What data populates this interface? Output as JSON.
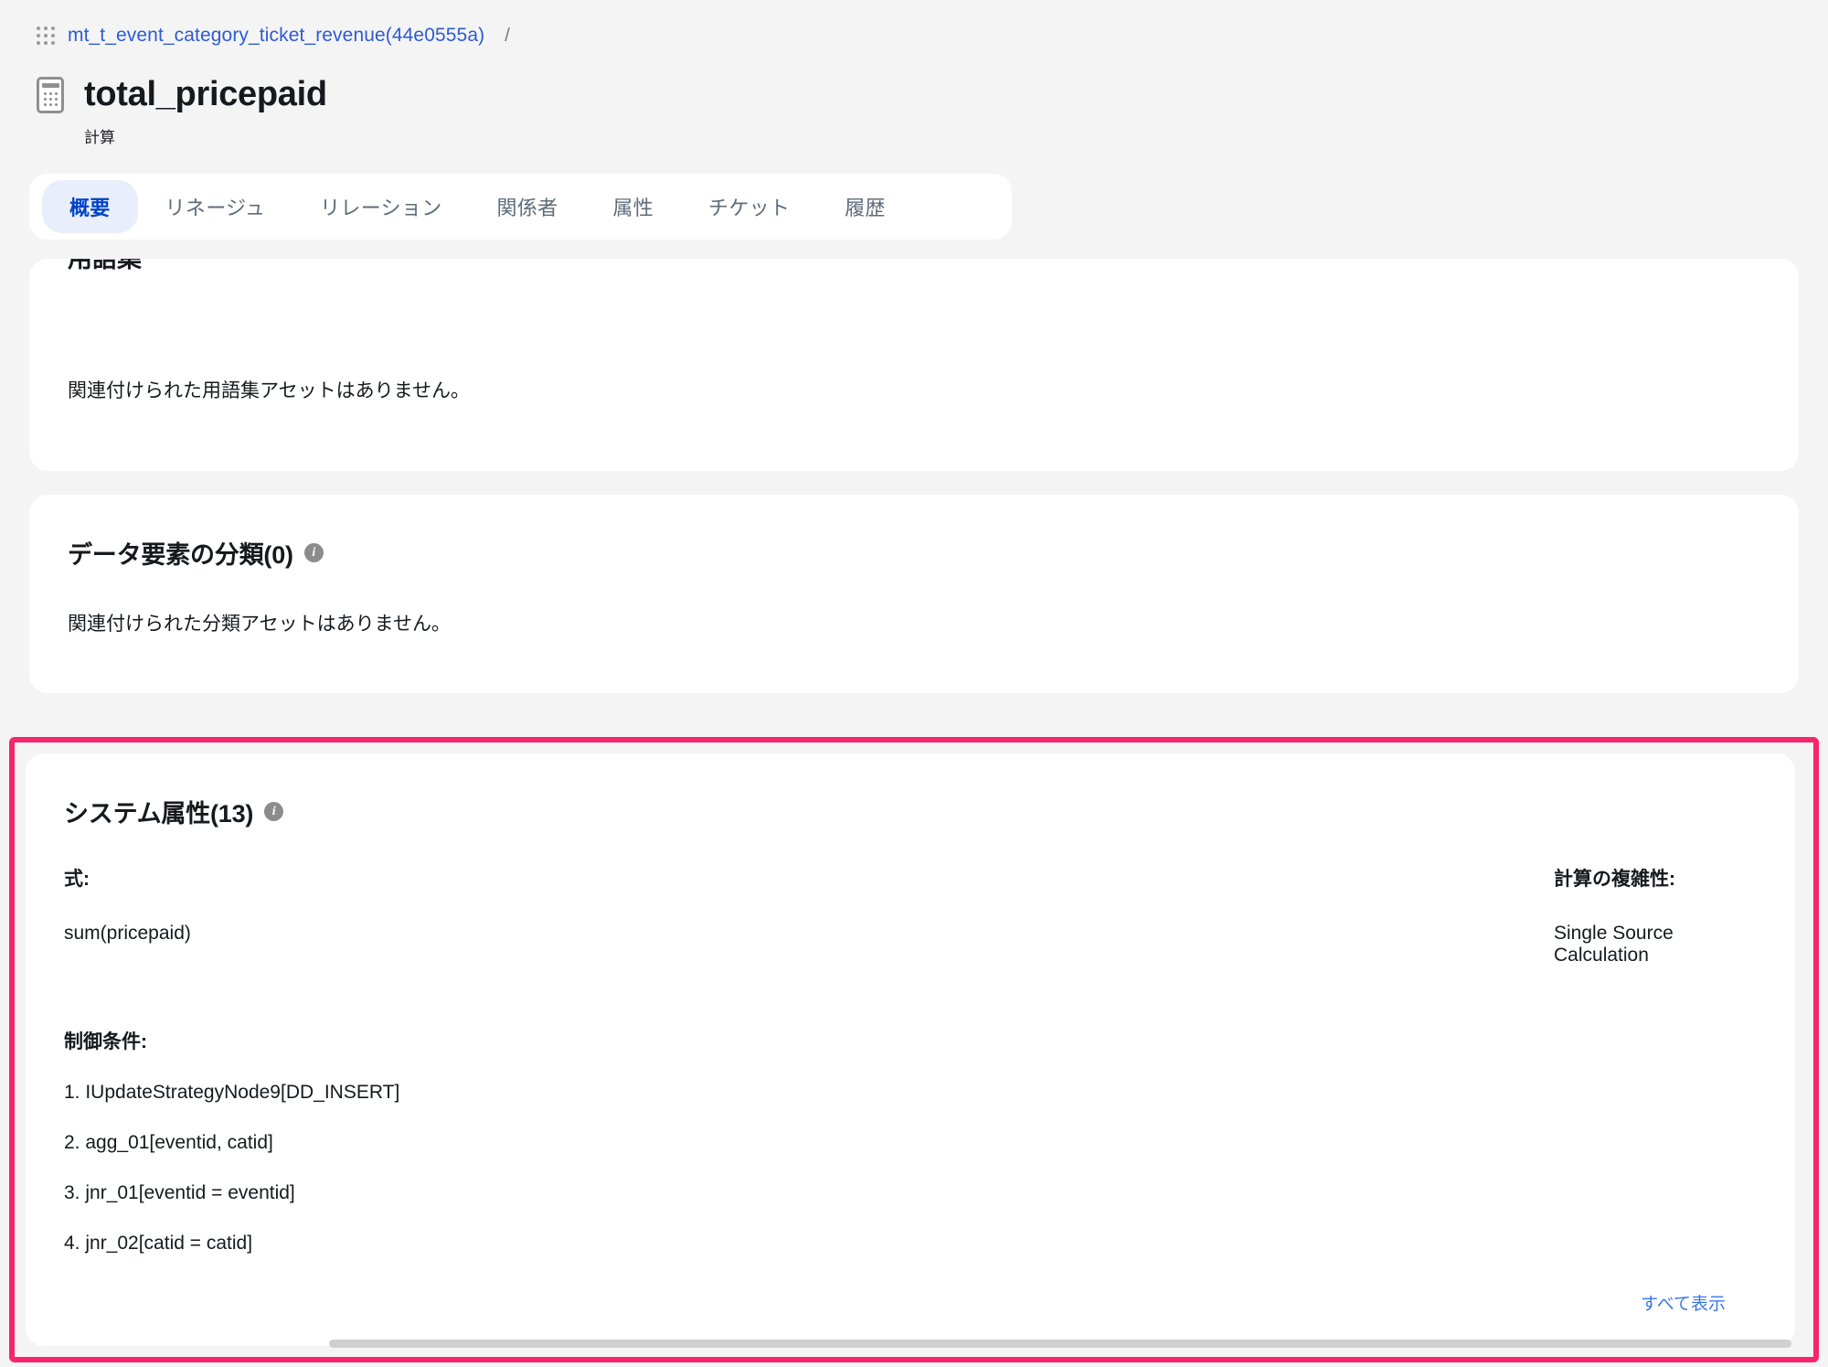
{
  "breadcrumb": {
    "app_menu_icon": "waffle-grid-icon",
    "link": "mt_t_event_category_ticket_revenue(44e0555a)",
    "separator": "/"
  },
  "header": {
    "icon": "calculator-icon",
    "title": "total_pricepaid",
    "subtitle": "計算"
  },
  "tabs": [
    {
      "label": "概要",
      "active": true
    },
    {
      "label": "リネージュ",
      "active": false
    },
    {
      "label": "リレーション",
      "active": false
    },
    {
      "label": "関係者",
      "active": false
    },
    {
      "label": "属性",
      "active": false
    },
    {
      "label": "チケット",
      "active": false
    },
    {
      "label": "履歴",
      "active": false
    }
  ],
  "cards": {
    "glossary": {
      "clipped_title": "用語集",
      "empty_text": "関連付けられた用語集アセットはありません。"
    },
    "classification": {
      "title": "データ要素の分類(0)",
      "info_icon": "info-icon",
      "empty_text": "関連付けられた分類アセットはありません。"
    },
    "system_attributes": {
      "title": "システム属性(13)",
      "info_icon": "info-icon",
      "highlight_color": "#f7256c",
      "expression_label": "式:",
      "expression_value": "sum(pricepaid)",
      "complexity_label": "計算の複雑性:",
      "complexity_value": "Single Source Calculation",
      "conditions_label": "制御条件:",
      "conditions": [
        "1. IUpdateStrategyNode9[DD_INSERT]",
        "2. agg_01[eventid, catid]",
        "3. jnr_01[eventid = eventid]",
        "4. jnr_02[catid = catid]"
      ],
      "view_all_label": "すべて表示"
    }
  }
}
